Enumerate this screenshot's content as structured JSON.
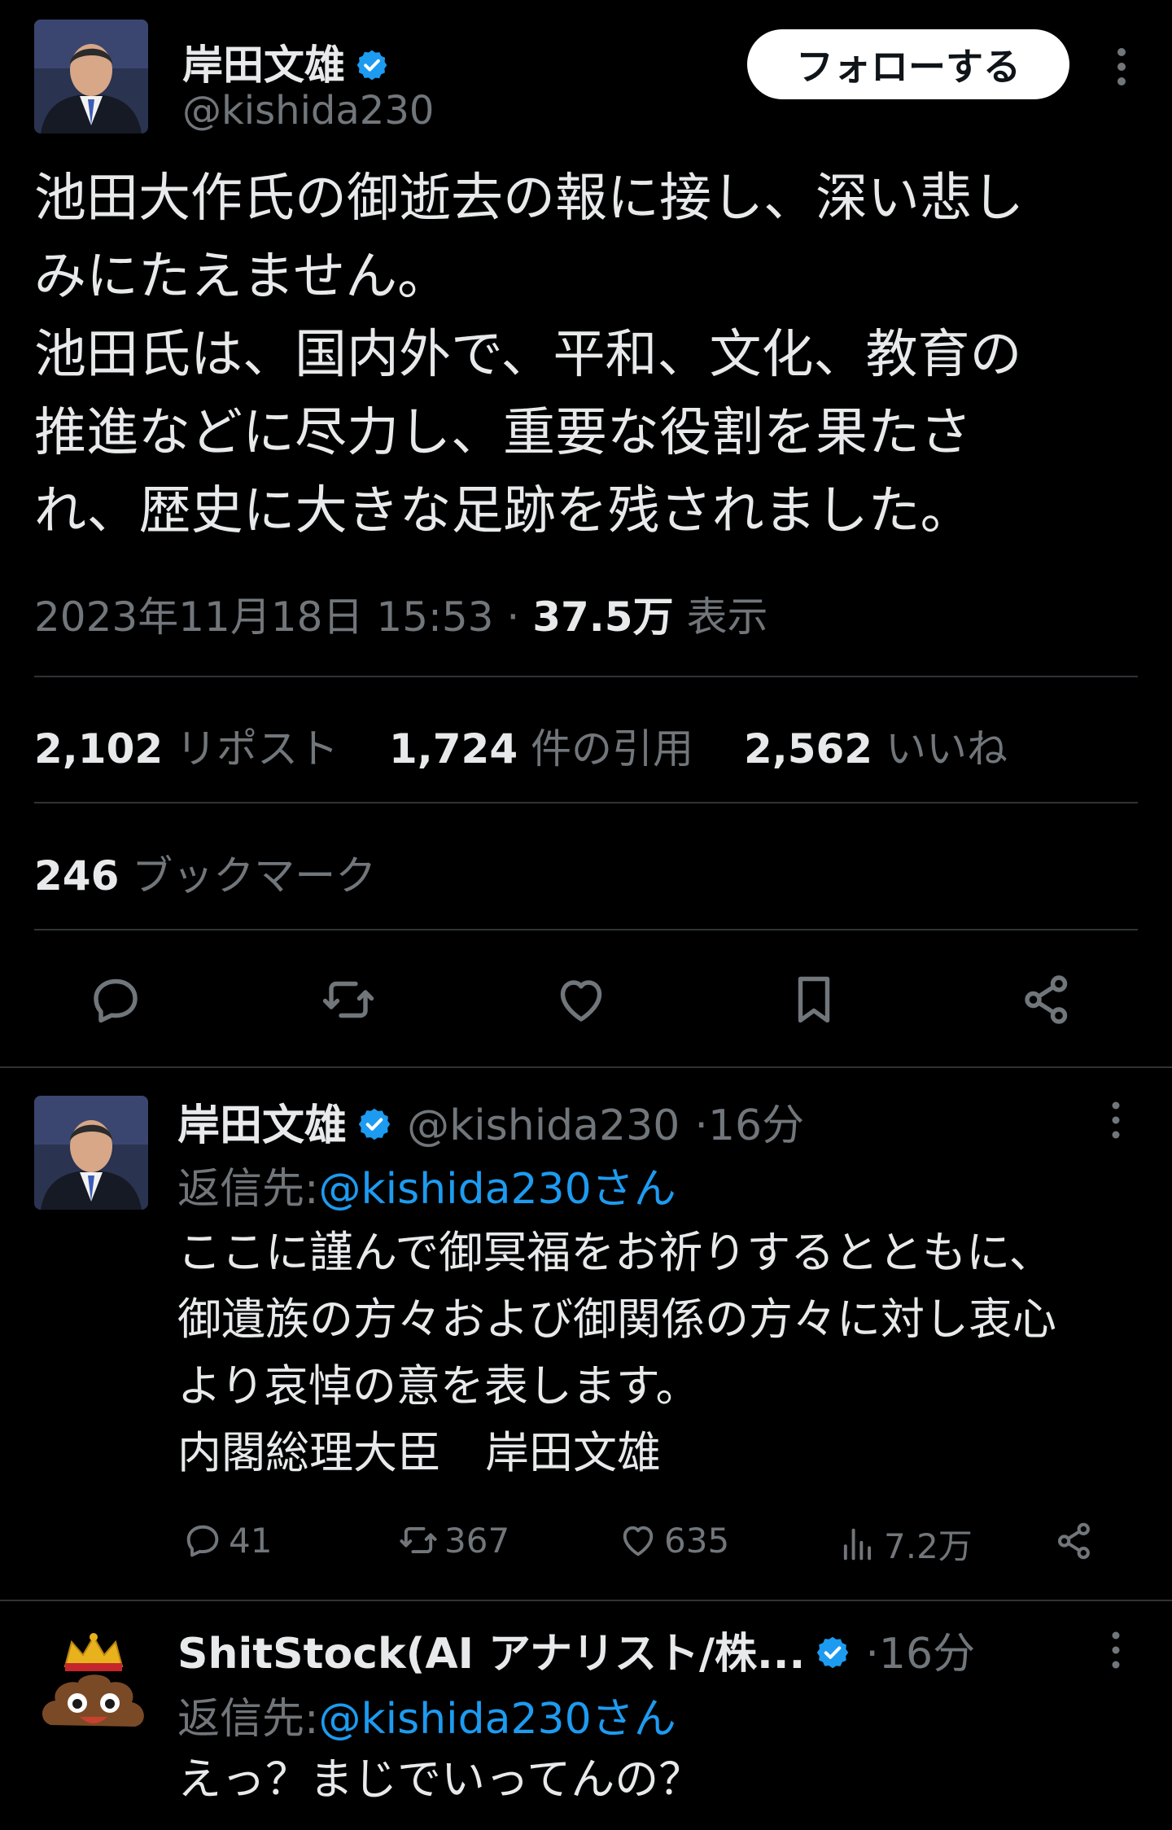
{
  "main_tweet": {
    "author_name": "岸田文雄",
    "author_handle": "@kishida230",
    "follow_label": "フォローする",
    "text_lines": [
      "池田大作氏の御逝去の報に接し、深い悲し",
      "みにたえません。",
      "池田氏は、国内外で、平和、文化、教育の",
      "推進などに尽力し、重要な役割を果たさ",
      "れ、歴史に大きな足跡を残されました。"
    ],
    "timestamp": "2023年11月18日 15:53",
    "separator": "·",
    "views_count": "37.5万",
    "views_label": "表示",
    "stats": {
      "reposts_count": "2,102",
      "reposts_label": "リポスト",
      "quotes_count": "1,724",
      "quotes_label": "件の引用",
      "likes_count": "2,562",
      "likes_label": "いいね",
      "bookmarks_count": "246",
      "bookmarks_label": "ブックマーク"
    },
    "actions": [
      "reply-icon",
      "repost-icon",
      "like-icon",
      "bookmark-icon",
      "share-icon"
    ]
  },
  "replies": [
    {
      "author_name": "岸田文雄",
      "author_handle": "@kishida230",
      "separator": "·",
      "time": "16分",
      "reply_to_label": "返信先:",
      "reply_to_handle": "@kishida230さん",
      "text_lines": [
        "ここに謹んで御冥福をお祈りするとともに、",
        "御遺族の方々および御関係の方々に対し衷心",
        "より哀悼の意を表します。",
        "内閣総理大臣　岸田文雄"
      ],
      "reply_count": "41",
      "repost_count": "367",
      "like_count": "635",
      "view_count": "7.2万"
    },
    {
      "author_name": "ShitStock(AI アナリスト/株...",
      "separator": "·",
      "time": "16分",
      "reply_to_label": "返信先:",
      "reply_to_handle": "@kishida230さん",
      "text_lines": [
        "えっ？まじでいってんの？"
      ]
    }
  ],
  "colors": {
    "background": "#000000",
    "text": "#e7e9ea",
    "muted": "#71767b",
    "link": "#1d9bf0",
    "verified": "#1d9bf0",
    "divider": "#2f3336"
  }
}
